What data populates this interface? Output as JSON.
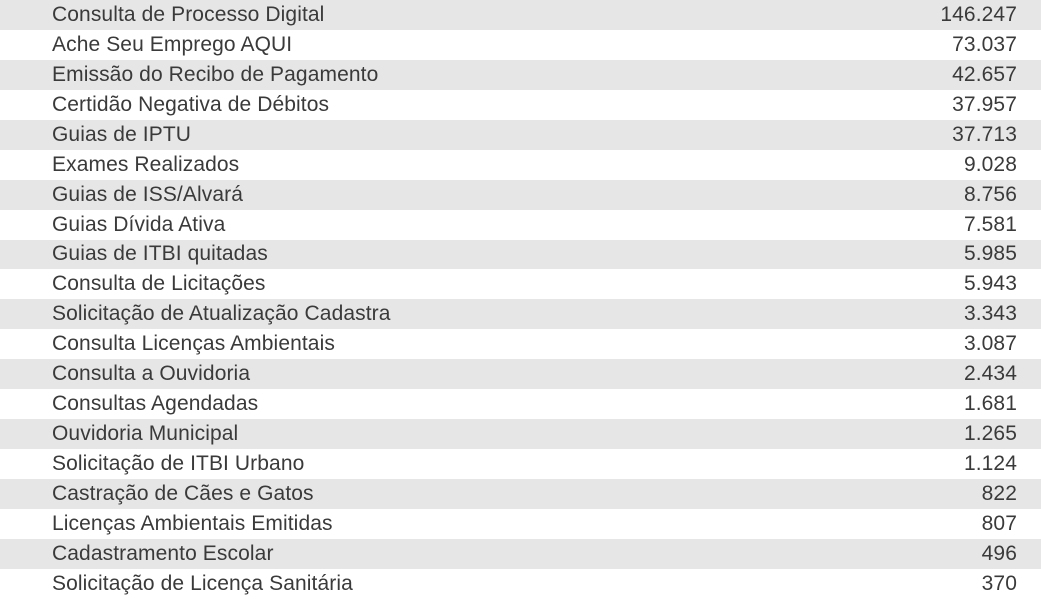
{
  "rows": [
    {
      "label": "Consulta de Processo Digital",
      "value": "146.247"
    },
    {
      "label": "Ache Seu Emprego AQUI",
      "value": "73.037"
    },
    {
      "label": "Emissão do Recibo de Pagamento",
      "value": "42.657"
    },
    {
      "label": "Certidão Negativa de Débitos",
      "value": "37.957"
    },
    {
      "label": "Guias de IPTU",
      "value": "37.713"
    },
    {
      "label": "Exames Realizados",
      "value": "9.028"
    },
    {
      "label": "Guias de ISS/Alvará",
      "value": "8.756"
    },
    {
      "label": "Guias Dívida Ativa",
      "value": "7.581"
    },
    {
      "label": "Guias de ITBI quitadas",
      "value": "5.985"
    },
    {
      "label": "Consulta de Licitações",
      "value": "5.943"
    },
    {
      "label": "Solicitação de Atualização Cadastra",
      "value": "3.343"
    },
    {
      "label": "Consulta Licenças Ambientais",
      "value": "3.087"
    },
    {
      "label": "Consulta a Ouvidoria",
      "value": "2.434"
    },
    {
      "label": "Consultas Agendadas",
      "value": "1.681"
    },
    {
      "label": "Ouvidoria Municipal",
      "value": "1.265"
    },
    {
      "label": "Solicitação de ITBI Urbano",
      "value": "1.124"
    },
    {
      "label": "Castração de Cães e Gatos",
      "value": "822"
    },
    {
      "label": "Licenças Ambientais Emitidas",
      "value": "807"
    },
    {
      "label": "Cadastramento Escolar",
      "value": "496"
    },
    {
      "label": "Solicitação de Licença Sanitária",
      "value": "370"
    }
  ]
}
